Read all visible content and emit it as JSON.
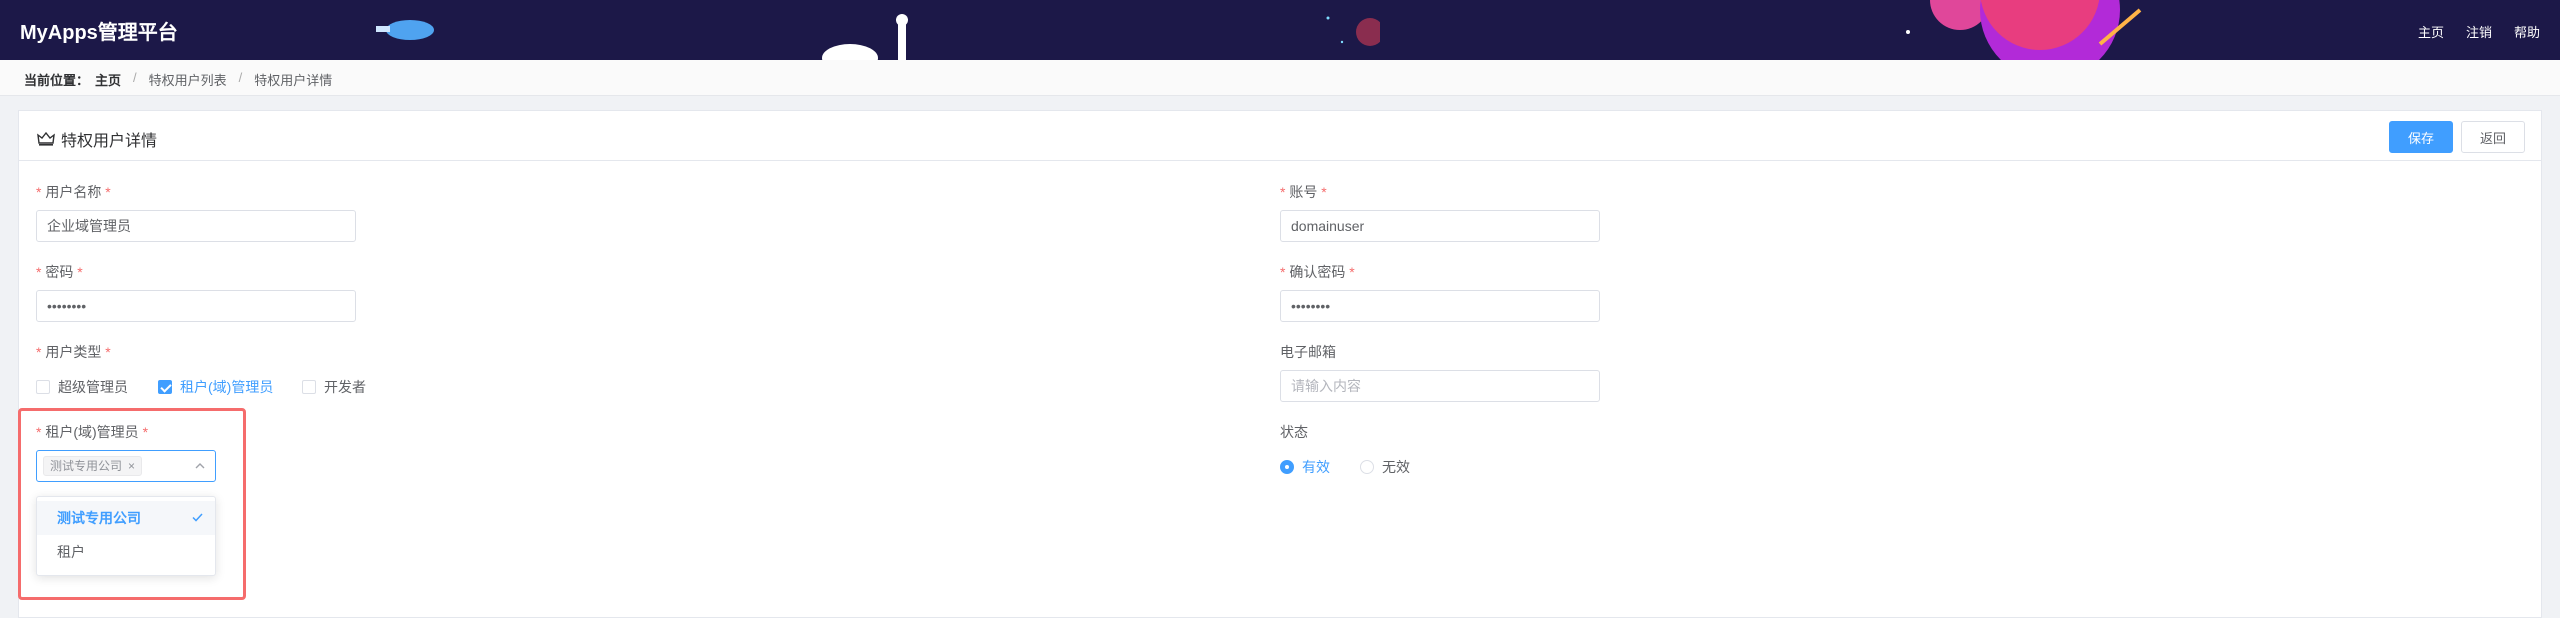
{
  "app": {
    "title": "MyApps管理平台"
  },
  "header": {
    "nav": [
      {
        "label": "主页"
      },
      {
        "label": "注销"
      },
      {
        "label": "帮助"
      }
    ]
  },
  "breadcrumb": {
    "label": "当前位置：",
    "items": [
      "主页",
      "特权用户列表",
      "特权用户详情"
    ],
    "sep": "/"
  },
  "panel": {
    "title": "特权用户详情",
    "save_label": "保存",
    "back_label": "返回"
  },
  "form": {
    "username": {
      "label": "用户名称",
      "value": "企业域管理员"
    },
    "account": {
      "label": "账号",
      "value": "domainuser"
    },
    "password": {
      "label": "密码",
      "value": "••••••••"
    },
    "confirm_password": {
      "label": "确认密码",
      "value": "••••••••"
    },
    "user_type": {
      "label": "用户类型",
      "options": [
        "超级管理员",
        "租户(域)管理员",
        "开发者"
      ],
      "checked": [
        false,
        true,
        false
      ]
    },
    "email": {
      "label": "电子邮箱",
      "placeholder": "请输入内容"
    },
    "tenant_admin": {
      "label": "租户(域)管理员",
      "selected_tag": "测试专用公司",
      "options": [
        "测试专用公司",
        "租户"
      ]
    },
    "status": {
      "label": "状态",
      "options": [
        "有效",
        "无效"
      ],
      "selected": "有效"
    },
    "required_mark": "*"
  },
  "colors": {
    "header_bg": "#1c1848",
    "accent": "#409eff",
    "required": "#f56c6c",
    "highlight": "#f56c6c"
  }
}
